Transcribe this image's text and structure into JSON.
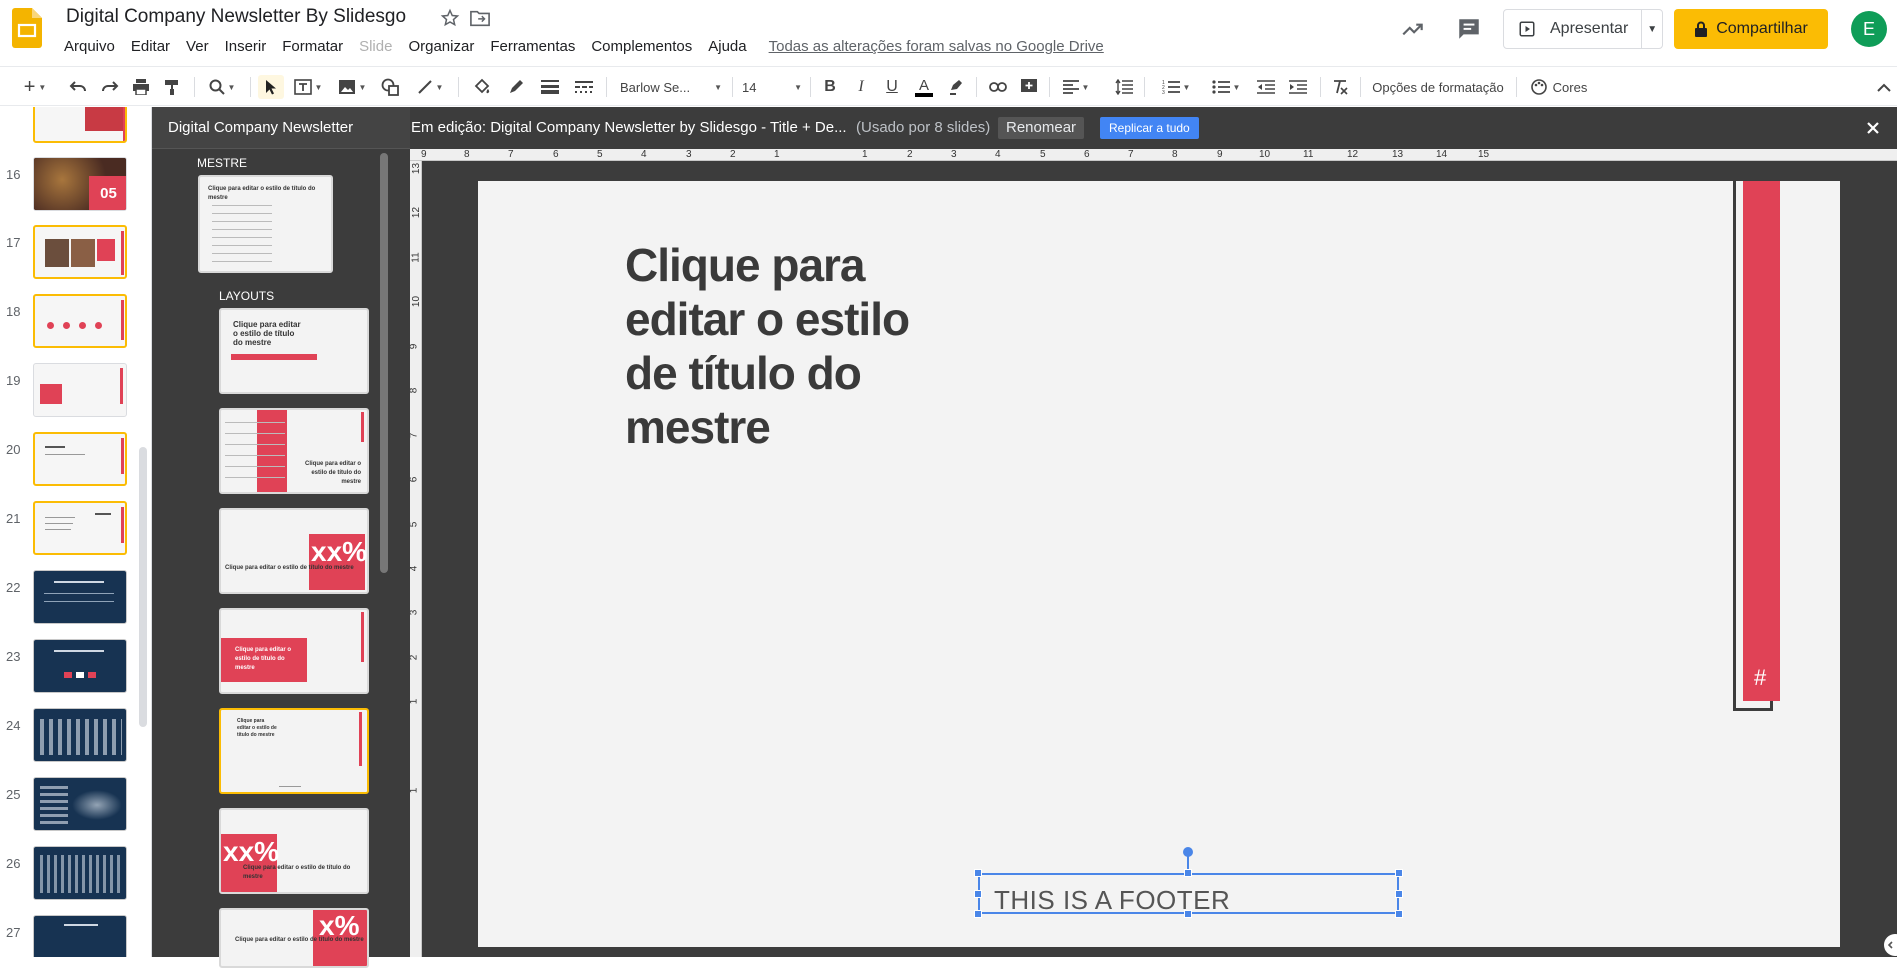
{
  "header": {
    "doc_title": "Digital Company Newsletter By Slidesgo",
    "menu": [
      "Arquivo",
      "Editar",
      "Ver",
      "Inserir",
      "Formatar",
      "Slide",
      "Organizar",
      "Ferramentas",
      "Complementos",
      "Ajuda"
    ],
    "save_status": "Todas as alterações foram salvas no Google Drive",
    "present_label": "Apresentar",
    "share_label": "Compartilhar",
    "avatar_initial": "E"
  },
  "toolbar": {
    "font_name": "Barlow Se...",
    "font_size": "14",
    "format_options": "Opções de formatação",
    "colors": "Cores"
  },
  "filmstrip": {
    "slides": [
      "16",
      "17",
      "18",
      "19",
      "20",
      "21",
      "22",
      "23",
      "24",
      "25",
      "26",
      "27"
    ]
  },
  "master_panel": {
    "title": "Digital Company Newsletter",
    "master_label": "MESTRE",
    "layouts_label": "LAYOUTS",
    "master_thumb_title": "Clique para editar o estilo de título do mestre",
    "layout1_text": "Clique para editar o estilo de título do mestre",
    "layout2_text": "Clique para editar o estilo de título do mestre",
    "layout3_text": "Clique para editar o estilo de título do mestre",
    "layout3_big": "xx%",
    "layout4_text": "Clique para editar o estilo de título do mestre",
    "layout5_text": "Clique para editar o estilo de título do mestre",
    "layout6_text": "Clique para editar o estilo de título do mestre",
    "layout6_big": "xx%",
    "layout7_text": "Clique para editar o estilo de título do mestre",
    "layout7_big": "x%"
  },
  "edit_bar": {
    "editing_text": "Em edição: Digital Company Newsletter by Slidesgo - Title + De...",
    "used_by": "(Usado por 8 slides)",
    "rename": "Renomear",
    "replicate": "Replicar a tudo"
  },
  "ruler": {
    "top": [
      "9",
      "8",
      "7",
      "6",
      "5",
      "4",
      "3",
      "2",
      "1",
      "1",
      "2",
      "3",
      "4",
      "5",
      "6",
      "7",
      "8",
      "9",
      "10",
      "11",
      "12",
      "13",
      "14",
      "15"
    ],
    "left": [
      "13",
      "12",
      "11",
      "10",
      "9",
      "8",
      "7",
      "6",
      "5",
      "4",
      "3",
      "2",
      "1",
      "1"
    ]
  },
  "slide": {
    "title": "Clique para editar o estilo de título do mestre",
    "page_number_placeholder": "#",
    "footer": "THIS IS A FOOTER"
  },
  "colors": {
    "accent_red": "#e04256",
    "share_yellow": "#fbbc04",
    "selection_blue": "#4a86e8",
    "dark_panel": "#3c3c3c"
  }
}
